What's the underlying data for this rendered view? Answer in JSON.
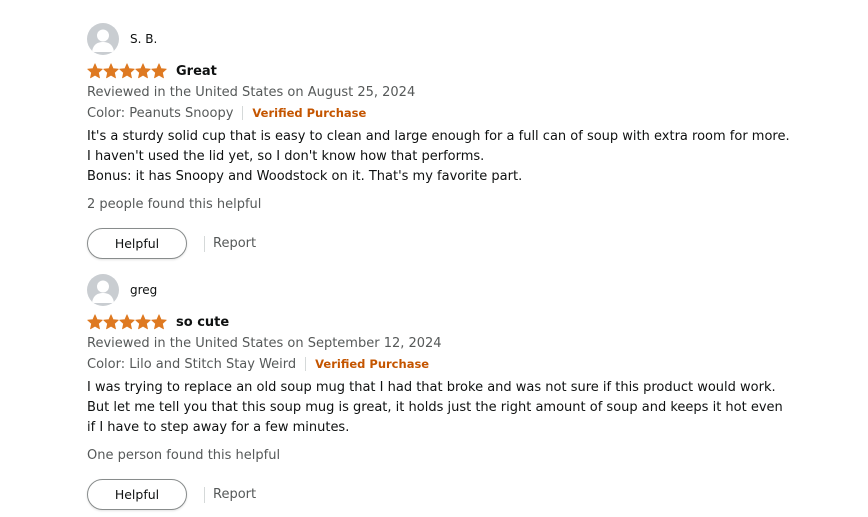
{
  "colors": {
    "star": "#de7921",
    "verified": "#c45500",
    "secondary_text": "#565959",
    "primary_text": "#0f1111"
  },
  "reviews": [
    {
      "profile_name": "S. B.",
      "avatar_icon": "user-avatar-icon",
      "rating": 5,
      "rating_max": 5,
      "title": "Great",
      "date_line": "Reviewed in the United States on August 25, 2024",
      "variant": "Color: Peanuts Snoopy",
      "verified_label": "Verified Purchase",
      "body_lines": [
        "It's a sturdy solid cup that is easy to clean and large enough for a full can of soup with extra room for more.",
        "I haven't used the lid yet, so I don't know how that performs.",
        "Bonus: it has Snoopy and Woodstock on it. That's my favorite part."
      ],
      "helpful_count": "2 people found this helpful",
      "helpful_label": "Helpful",
      "report_label": "Report"
    },
    {
      "profile_name": "greg",
      "avatar_icon": "user-avatar-icon",
      "rating": 5,
      "rating_max": 5,
      "title": "so cute",
      "date_line": "Reviewed in the United States on September 12, 2024",
      "variant": "Color: Lilo and Stitch Stay Weird",
      "verified_label": "Verified Purchase",
      "body_lines": [
        "I was trying to replace an old soup mug that I had that broke and was not sure if this product would work.",
        "But let me tell you that this soup mug is great, it holds just the right amount of soup and keeps it hot even",
        "if I have to step away for a few minutes."
      ],
      "helpful_count": "One person found this helpful",
      "helpful_label": "Helpful",
      "report_label": "Report"
    }
  ]
}
